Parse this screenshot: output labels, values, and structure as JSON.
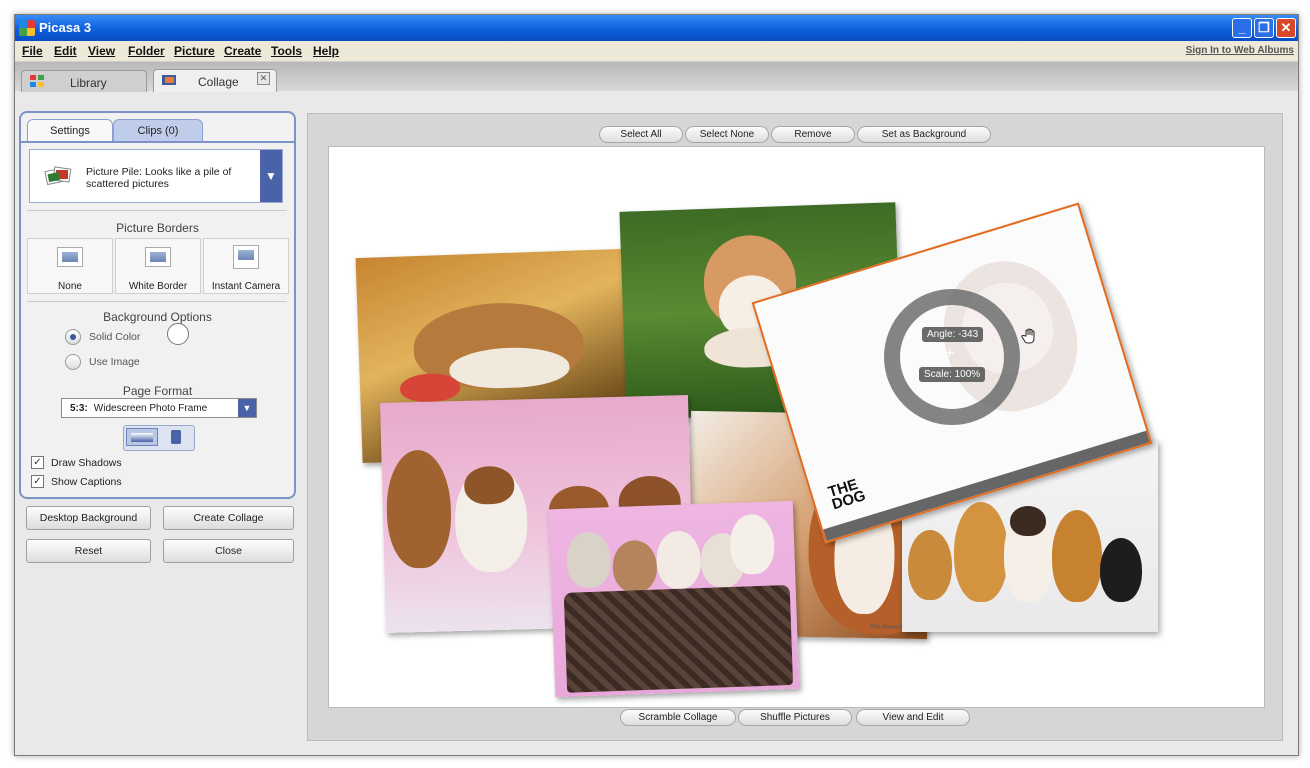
{
  "window": {
    "title": "Picasa 3",
    "minimize": "_",
    "maximize": "❐",
    "close": "✕"
  },
  "menu": {
    "items": [
      "File",
      "Edit",
      "View",
      "Folder",
      "Picture",
      "Create",
      "Tools",
      "Help"
    ],
    "sign_in": "Sign In to Web Albums"
  },
  "tabs": {
    "library": "Library",
    "collage": "Collage",
    "close_glyph": "✕"
  },
  "settings": {
    "tab_settings": "Settings",
    "tab_clips": "Clips (0)",
    "collage_type": "Picture Pile:  Looks like a pile of scattered pictures",
    "dropdown_arrow": "▼",
    "picture_borders_title": "Picture Borders",
    "borders": [
      "None",
      "White Border",
      "Instant Camera"
    ],
    "background_title": "Background Options",
    "solid_color": "Solid Color",
    "use_image": "Use Image",
    "page_format_title": "Page Format",
    "page_format_ratio": "5:3:",
    "page_format_value": "Widescreen Photo Frame",
    "select_arrow": "▼",
    "draw_shadows": "Draw Shadows",
    "show_captions": "Show Captions",
    "check_glyph": "✓"
  },
  "actions": {
    "desktop_background": "Desktop Background",
    "create_collage": "Create Collage",
    "reset": "Reset",
    "close": "Close"
  },
  "toolbar_top": {
    "select_all": "Select All",
    "select_none": "Select None",
    "remove": "Remove",
    "set_background": "Set as Background"
  },
  "toolbar_bottom": {
    "scramble": "Scramble Collage",
    "shuffle": "Shuffle Pictures",
    "view_edit": "View and Edit"
  },
  "rotation": {
    "angle": "Angle: -343",
    "scale": "Scale: 100%"
  },
  "photo_text": {
    "logo_the": "THE",
    "logo_dog": "DOG",
    "watermark": "http://www.luyun.com"
  },
  "colors": {
    "accent": "#4a63a8",
    "selection": "#e46a1c",
    "titlebar": "#0d5fdc"
  }
}
